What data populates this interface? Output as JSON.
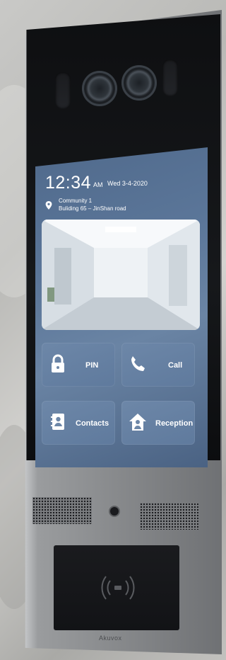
{
  "status": {
    "time": "12:34",
    "ampm": "AM",
    "date": "Wed 3-4-2020",
    "location_line1": "Community 1",
    "location_line2": "Buliding 65 – JinShan road"
  },
  "buttons": [
    {
      "id": "pin",
      "label": "PIN",
      "icon": "lock-icon"
    },
    {
      "id": "call",
      "label": "Call",
      "icon": "phone-icon"
    },
    {
      "id": "contacts",
      "label": "Contacts",
      "icon": "contacts-icon"
    },
    {
      "id": "reception",
      "label": "Reception",
      "icon": "reception-icon"
    }
  ],
  "brand": "Akuvox",
  "colors": {
    "screen_bg": "#5b7699",
    "tile_bg": "#6d87a8",
    "text": "#ffffff"
  }
}
